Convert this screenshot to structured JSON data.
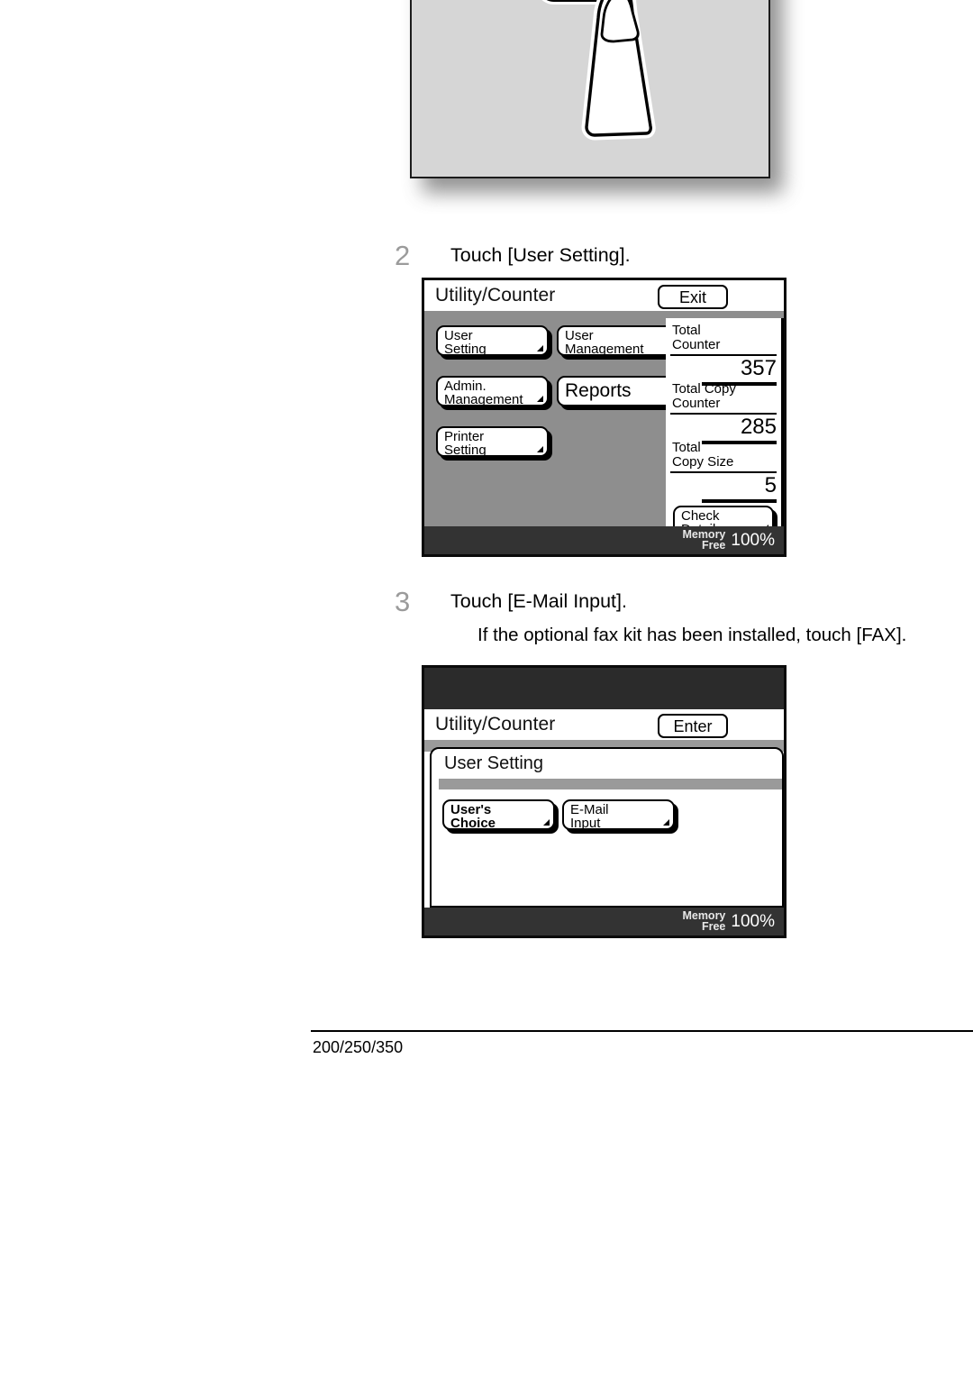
{
  "document": {
    "footer_rule": true,
    "footer_text": "200/250/350"
  },
  "illustration": {
    "name": "finger-touching-control-panel",
    "description": "Hand with index finger pressing a rounded rectangular button on the copier control panel",
    "panel_color": "#d6d6d6"
  },
  "steps": [
    {
      "number": "2",
      "instruction": "Touch [User Setting].",
      "note": ""
    },
    {
      "number": "3",
      "instruction": "Touch [E-Mail Input].",
      "note": "If the optional fax kit has been installed, touch [FAX]."
    }
  ],
  "screen_utility_counter": {
    "title": "Utility/Counter",
    "exit_button": "Exit",
    "buttons": [
      {
        "line1": "User",
        "line2": "Setting"
      },
      {
        "line1": "User",
        "line2": "Management"
      },
      {
        "line1": "Admin.",
        "line2": "Management"
      },
      {
        "line1": "Reports",
        "line2": ""
      },
      {
        "line1": "Printer",
        "line2": "Setting"
      }
    ],
    "counters": [
      {
        "label": "Total\nCounter",
        "value": "357"
      },
      {
        "label": "Total Copy\nCounter",
        "value": "285"
      },
      {
        "label": "Total\nCopy Size",
        "value": "5"
      }
    ],
    "check_detail_button": {
      "line1": "Check",
      "line2": "Detail"
    },
    "status": {
      "memory_line1": "Memory",
      "memory_line2": "Free",
      "percent": "100%"
    }
  },
  "screen_user_setting": {
    "title": "Utility/Counter",
    "enter_button": "Enter",
    "subpanel_title": "User Setting",
    "buttons": [
      {
        "line1": "User's",
        "line2": "Choice"
      },
      {
        "line1": "E-Mail",
        "line2": "Input"
      }
    ],
    "status": {
      "memory_line1": "Memory",
      "memory_line2": "Free",
      "percent": "100%"
    }
  },
  "colors": {
    "lcd_background": "#8e8e8e",
    "lcd_titlebar": "#ffffff",
    "lcd_status_bar": "#333333",
    "panel_black_band": "#2b2b2b",
    "step_number": "#9b9b9b"
  }
}
